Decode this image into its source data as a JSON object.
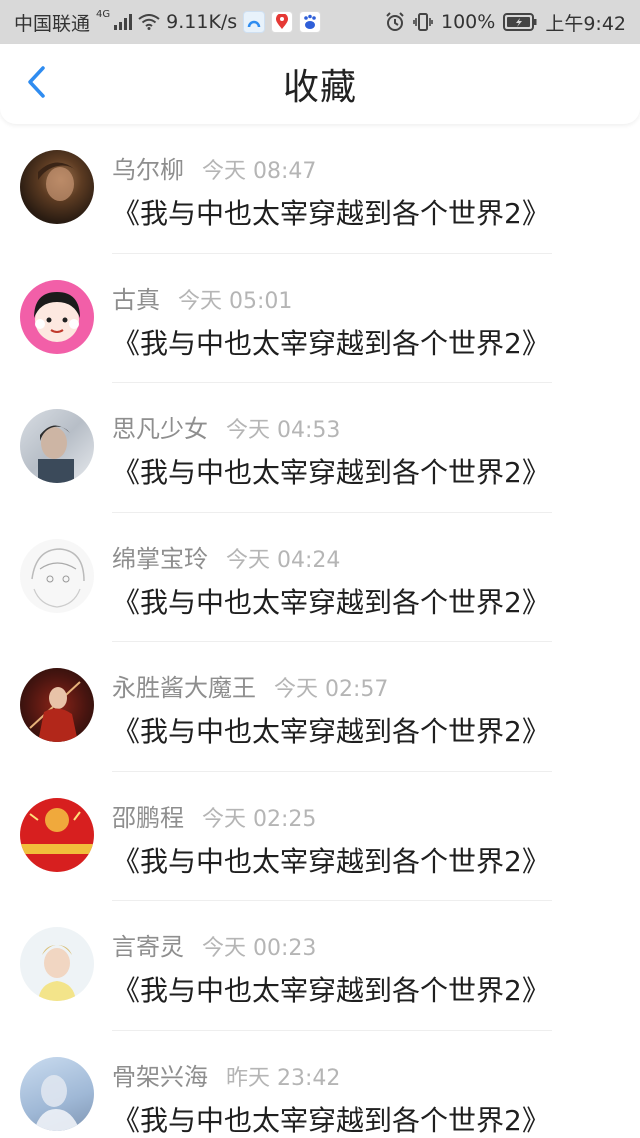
{
  "status_bar": {
    "carrier": "中国联通",
    "network_badge": "4G",
    "speed": "9.11K/s",
    "battery": "100%",
    "time": "上午9:42",
    "icons": [
      "signal-icon",
      "wifi-icon",
      "app-icon-blue",
      "app-icon-map",
      "app-icon-baidu",
      "alarm-icon",
      "vibrate-icon",
      "battery-icon"
    ]
  },
  "header": {
    "title": "收藏",
    "back_icon": "chevron-left-icon",
    "accent_color": "#2f8cf0"
  },
  "items": [
    {
      "username": "乌尔柳",
      "time": "今天 08:47",
      "title": "《我与中也太宰穿越到各个世界2》"
    },
    {
      "username": "古真",
      "time": "今天 05:01",
      "title": "《我与中也太宰穿越到各个世界2》"
    },
    {
      "username": "思凡少女",
      "time": "今天 04:53",
      "title": "《我与中也太宰穿越到各个世界2》"
    },
    {
      "username": "绵掌宝玲",
      "time": "今天 04:24",
      "title": "《我与中也太宰穿越到各个世界2》"
    },
    {
      "username": "永胜酱大魔王",
      "time": "今天 02:57",
      "title": "《我与中也太宰穿越到各个世界2》"
    },
    {
      "username": "邵鹏程",
      "time": "今天 02:25",
      "title": "《我与中也太宰穿越到各个世界2》"
    },
    {
      "username": "言寄灵",
      "time": "今天 00:23",
      "title": "《我与中也太宰穿越到各个世界2》"
    },
    {
      "username": "骨架兴海",
      "time": "昨天 23:42",
      "title": "《我与中也太宰穿越到各个世界2》"
    }
  ]
}
